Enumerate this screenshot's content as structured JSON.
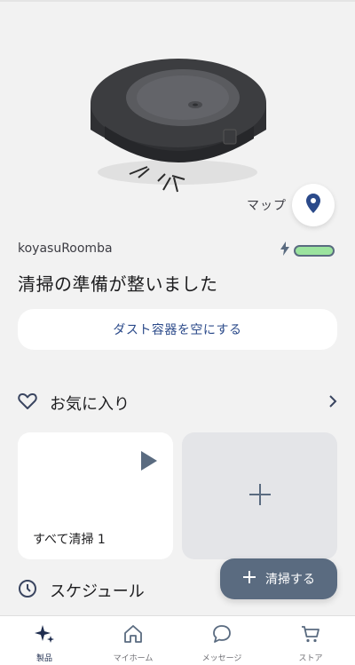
{
  "robot": {
    "name": "koyasuRoomba",
    "status": "清掃の準備が整いました",
    "battery_level": 1.0,
    "battery_color": "#9be39e",
    "charging": true
  },
  "map": {
    "label": "マップ",
    "icon": "map-pin-icon"
  },
  "actions": {
    "empty_bin": "ダスト容器を空にする"
  },
  "favorites": {
    "title": "お気に入り",
    "icon": "heart-icon",
    "items": [
      {
        "label": "すべて清掃 1",
        "icon": "play-icon"
      }
    ],
    "add_icon": "plus-icon"
  },
  "schedule": {
    "title": "スケジュール",
    "icon": "clock-icon"
  },
  "fab": {
    "label": "清掃する",
    "icon": "plus-icon"
  },
  "tabs": [
    {
      "label": "製品",
      "icon": "sparkle-icon",
      "active": true
    },
    {
      "label": "マイホーム",
      "icon": "home-icon",
      "active": false
    },
    {
      "label": "メッセージ",
      "icon": "chat-icon",
      "active": false
    },
    {
      "label": "ストア",
      "icon": "cart-icon",
      "active": false
    }
  ],
  "colors": {
    "accent": "#2b4a8a",
    "fab_bg": "#5a6b80",
    "background": "#f2f2f2"
  }
}
